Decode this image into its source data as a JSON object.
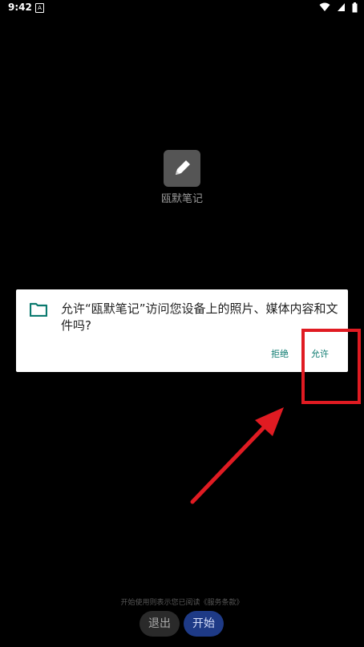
{
  "status_bar": {
    "time": "9:42",
    "notification_icon": "A",
    "icons": [
      "wifi-icon",
      "signal-icon",
      "battery-icon"
    ]
  },
  "splash": {
    "app_name": "瓯默笔记",
    "icon": "pen-icon"
  },
  "dialog": {
    "message": "允许“瓯默笔记”访问您设备上的照片、媒体内容和文件吗?",
    "icon": "folder-icon",
    "deny_label": "拒绝",
    "allow_label": "允许"
  },
  "bottom": {
    "agreement_text": "开始使用则表示您已阅读《服务条款》",
    "exit_label": "退出",
    "start_label": "开始"
  },
  "colors": {
    "background": "#000000",
    "dialog_bg": "#ffffff",
    "accent": "#0b7a6f",
    "annotation": "#e01b22",
    "start_button": "#1e3a86"
  }
}
